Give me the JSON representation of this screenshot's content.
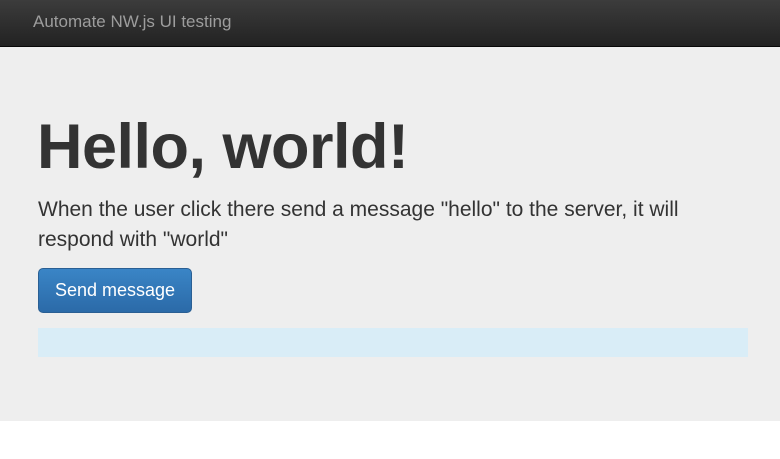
{
  "navbar": {
    "brand": "Automate NW.js UI testing"
  },
  "jumbotron": {
    "title": "Hello, world!",
    "description": "When the user click there send a message \"hello\" to the server, it will respond with \"world\"",
    "send_button_label": "Send message",
    "response_text": ""
  },
  "colors": {
    "navbar_bg": "#222222",
    "jumbotron_bg": "#eeeeee",
    "primary_button": "#337ab7",
    "info_alert_bg": "#d9edf7"
  }
}
